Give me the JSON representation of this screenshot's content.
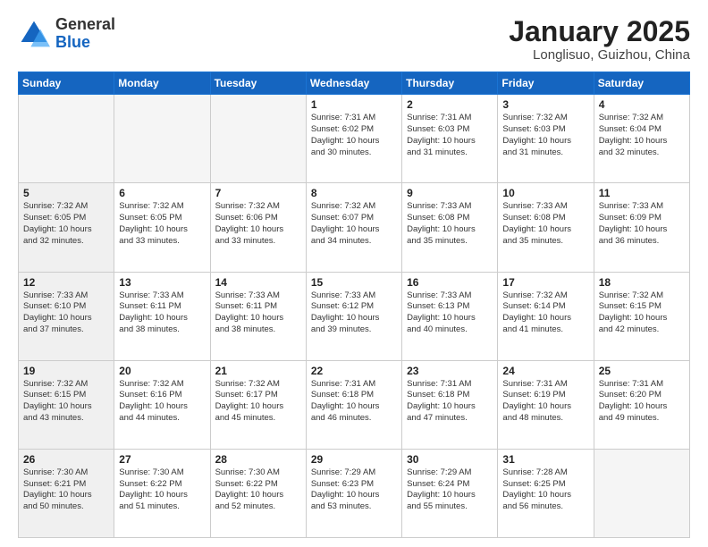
{
  "logo": {
    "general": "General",
    "blue": "Blue"
  },
  "header": {
    "title": "January 2025",
    "subtitle": "Longlisuo, Guizhou, China"
  },
  "weekdays": [
    "Sunday",
    "Monday",
    "Tuesday",
    "Wednesday",
    "Thursday",
    "Friday",
    "Saturday"
  ],
  "weeks": [
    [
      {
        "day": "",
        "empty": true
      },
      {
        "day": "",
        "empty": true
      },
      {
        "day": "",
        "empty": true
      },
      {
        "day": "1",
        "lines": [
          "Sunrise: 7:31 AM",
          "Sunset: 6:02 PM",
          "Daylight: 10 hours",
          "and 30 minutes."
        ]
      },
      {
        "day": "2",
        "lines": [
          "Sunrise: 7:31 AM",
          "Sunset: 6:03 PM",
          "Daylight: 10 hours",
          "and 31 minutes."
        ]
      },
      {
        "day": "3",
        "lines": [
          "Sunrise: 7:32 AM",
          "Sunset: 6:03 PM",
          "Daylight: 10 hours",
          "and 31 minutes."
        ]
      },
      {
        "day": "4",
        "lines": [
          "Sunrise: 7:32 AM",
          "Sunset: 6:04 PM",
          "Daylight: 10 hours",
          "and 32 minutes."
        ]
      }
    ],
    [
      {
        "day": "5",
        "shaded": true,
        "lines": [
          "Sunrise: 7:32 AM",
          "Sunset: 6:05 PM",
          "Daylight: 10 hours",
          "and 32 minutes."
        ]
      },
      {
        "day": "6",
        "lines": [
          "Sunrise: 7:32 AM",
          "Sunset: 6:05 PM",
          "Daylight: 10 hours",
          "and 33 minutes."
        ]
      },
      {
        "day": "7",
        "lines": [
          "Sunrise: 7:32 AM",
          "Sunset: 6:06 PM",
          "Daylight: 10 hours",
          "and 33 minutes."
        ]
      },
      {
        "day": "8",
        "lines": [
          "Sunrise: 7:32 AM",
          "Sunset: 6:07 PM",
          "Daylight: 10 hours",
          "and 34 minutes."
        ]
      },
      {
        "day": "9",
        "lines": [
          "Sunrise: 7:33 AM",
          "Sunset: 6:08 PM",
          "Daylight: 10 hours",
          "and 35 minutes."
        ]
      },
      {
        "day": "10",
        "lines": [
          "Sunrise: 7:33 AM",
          "Sunset: 6:08 PM",
          "Daylight: 10 hours",
          "and 35 minutes."
        ]
      },
      {
        "day": "11",
        "lines": [
          "Sunrise: 7:33 AM",
          "Sunset: 6:09 PM",
          "Daylight: 10 hours",
          "and 36 minutes."
        ]
      }
    ],
    [
      {
        "day": "12",
        "shaded": true,
        "lines": [
          "Sunrise: 7:33 AM",
          "Sunset: 6:10 PM",
          "Daylight: 10 hours",
          "and 37 minutes."
        ]
      },
      {
        "day": "13",
        "lines": [
          "Sunrise: 7:33 AM",
          "Sunset: 6:11 PM",
          "Daylight: 10 hours",
          "and 38 minutes."
        ]
      },
      {
        "day": "14",
        "lines": [
          "Sunrise: 7:33 AM",
          "Sunset: 6:11 PM",
          "Daylight: 10 hours",
          "and 38 minutes."
        ]
      },
      {
        "day": "15",
        "lines": [
          "Sunrise: 7:33 AM",
          "Sunset: 6:12 PM",
          "Daylight: 10 hours",
          "and 39 minutes."
        ]
      },
      {
        "day": "16",
        "lines": [
          "Sunrise: 7:33 AM",
          "Sunset: 6:13 PM",
          "Daylight: 10 hours",
          "and 40 minutes."
        ]
      },
      {
        "day": "17",
        "lines": [
          "Sunrise: 7:32 AM",
          "Sunset: 6:14 PM",
          "Daylight: 10 hours",
          "and 41 minutes."
        ]
      },
      {
        "day": "18",
        "lines": [
          "Sunrise: 7:32 AM",
          "Sunset: 6:15 PM",
          "Daylight: 10 hours",
          "and 42 minutes."
        ]
      }
    ],
    [
      {
        "day": "19",
        "shaded": true,
        "lines": [
          "Sunrise: 7:32 AM",
          "Sunset: 6:15 PM",
          "Daylight: 10 hours",
          "and 43 minutes."
        ]
      },
      {
        "day": "20",
        "lines": [
          "Sunrise: 7:32 AM",
          "Sunset: 6:16 PM",
          "Daylight: 10 hours",
          "and 44 minutes."
        ]
      },
      {
        "day": "21",
        "lines": [
          "Sunrise: 7:32 AM",
          "Sunset: 6:17 PM",
          "Daylight: 10 hours",
          "and 45 minutes."
        ]
      },
      {
        "day": "22",
        "lines": [
          "Sunrise: 7:31 AM",
          "Sunset: 6:18 PM",
          "Daylight: 10 hours",
          "and 46 minutes."
        ]
      },
      {
        "day": "23",
        "lines": [
          "Sunrise: 7:31 AM",
          "Sunset: 6:18 PM",
          "Daylight: 10 hours",
          "and 47 minutes."
        ]
      },
      {
        "day": "24",
        "lines": [
          "Sunrise: 7:31 AM",
          "Sunset: 6:19 PM",
          "Daylight: 10 hours",
          "and 48 minutes."
        ]
      },
      {
        "day": "25",
        "lines": [
          "Sunrise: 7:31 AM",
          "Sunset: 6:20 PM",
          "Daylight: 10 hours",
          "and 49 minutes."
        ]
      }
    ],
    [
      {
        "day": "26",
        "shaded": true,
        "lines": [
          "Sunrise: 7:30 AM",
          "Sunset: 6:21 PM",
          "Daylight: 10 hours",
          "and 50 minutes."
        ]
      },
      {
        "day": "27",
        "lines": [
          "Sunrise: 7:30 AM",
          "Sunset: 6:22 PM",
          "Daylight: 10 hours",
          "and 51 minutes."
        ]
      },
      {
        "day": "28",
        "lines": [
          "Sunrise: 7:30 AM",
          "Sunset: 6:22 PM",
          "Daylight: 10 hours",
          "and 52 minutes."
        ]
      },
      {
        "day": "29",
        "lines": [
          "Sunrise: 7:29 AM",
          "Sunset: 6:23 PM",
          "Daylight: 10 hours",
          "and 53 minutes."
        ]
      },
      {
        "day": "30",
        "lines": [
          "Sunrise: 7:29 AM",
          "Sunset: 6:24 PM",
          "Daylight: 10 hours",
          "and 55 minutes."
        ]
      },
      {
        "day": "31",
        "lines": [
          "Sunrise: 7:28 AM",
          "Sunset: 6:25 PM",
          "Daylight: 10 hours",
          "and 56 minutes."
        ]
      },
      {
        "day": "",
        "empty": true
      }
    ]
  ]
}
